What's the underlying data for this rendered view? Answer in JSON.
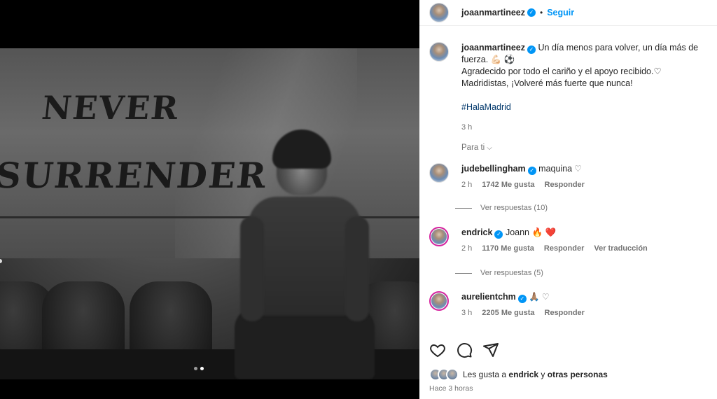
{
  "post": {
    "author": "joaanmartineez",
    "follow_label": "Seguir",
    "separator": "•",
    "graffiti_line1": "NEVER",
    "graffiti_line2": "SURRENDER",
    "carousel": {
      "count": 2,
      "active_index": 1
    }
  },
  "caption": {
    "username": "joaanmartineez",
    "line1": "Un día menos para volver, un día más de",
    "line2": "fuerza. 💪🏻 ⚽",
    "line3": "Agradecido por todo el cariño y el apoyo recibido.♡",
    "line4": "Madridistas, ¡Volveré más fuerte que nunca!",
    "hashtag": "#HalaMadrid",
    "time": "3 h"
  },
  "filter": {
    "label": "Para ti",
    "chevron": "chevron-down-icon"
  },
  "comments": [
    {
      "username": "judebellingham",
      "text": "maquina",
      "time": "2 h",
      "likes": "1742 Me gusta",
      "reply": "Responder",
      "translate": "",
      "view_replies": "Ver respuestas (10)"
    },
    {
      "username": "endrick",
      "text": "Joann 🔥 ❤️",
      "time": "2 h",
      "likes": "1170 Me gusta",
      "reply": "Responder",
      "translate": "Ver traducción",
      "view_replies": "Ver respuestas (5)"
    },
    {
      "username": "aurelientchm",
      "text": "🙏🏽",
      "time": "3 h",
      "likes": "2205 Me gusta",
      "reply": "Responder",
      "translate": "",
      "view_replies": ""
    }
  ],
  "likes": {
    "prefix": "Les gusta a",
    "user": "endrick",
    "and": "y",
    "others": "otras personas"
  },
  "posted_ago": "Hace 3 horas",
  "colors": {
    "accent": "#0095f6",
    "hashtag": "#00376b",
    "muted": "#737373",
    "heart_red": "#ff3040"
  }
}
